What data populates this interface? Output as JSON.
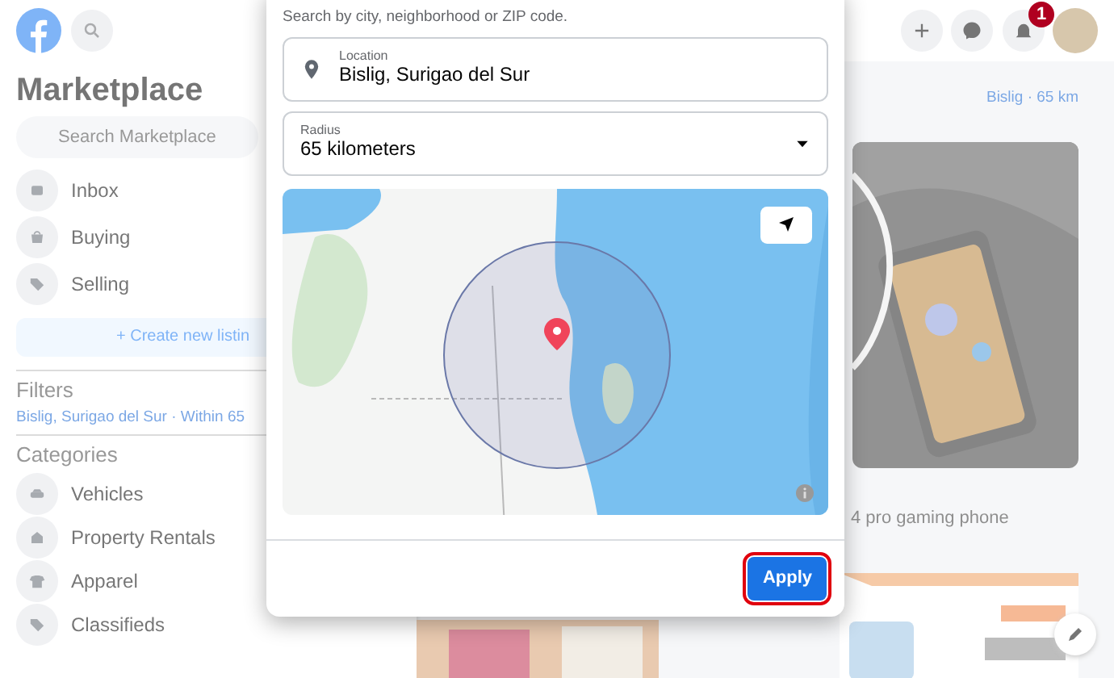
{
  "background": {
    "notification_count": "1",
    "sidebar": {
      "title": "Marketplace",
      "search": {
        "placeholder": "Search Marketplace"
      },
      "items": [
        {
          "label": "Inbox",
          "kind": "inbox"
        },
        {
          "label": "Buying",
          "kind": "bag"
        },
        {
          "label": "Selling",
          "kind": "tag"
        }
      ],
      "create_button": {
        "icon": "+",
        "label": "Create new listin"
      },
      "filters": {
        "heading": "Filters",
        "value": "Bislig, Surigao del Sur · Within 65"
      },
      "categories": {
        "heading": "Categories",
        "items": [
          {
            "label": "Vehicles",
            "kind": "car"
          },
          {
            "label": "Property Rentals",
            "kind": "house"
          },
          {
            "label": "Apparel",
            "kind": "shirt"
          },
          {
            "label": "Classifieds",
            "kind": "tag"
          }
        ]
      }
    },
    "location_chip": "Bislig · 65 km",
    "listing_title": "4 pro gaming phone"
  },
  "dialog": {
    "hint": "Search by city, neighborhood or ZIP code.",
    "location": {
      "label": "Location",
      "value": "Bislig, Surigao del Sur"
    },
    "radius": {
      "label": "Radius",
      "value": "65 kilometers"
    },
    "apply_button": {
      "label": "Apply",
      "highlighted": true
    }
  }
}
